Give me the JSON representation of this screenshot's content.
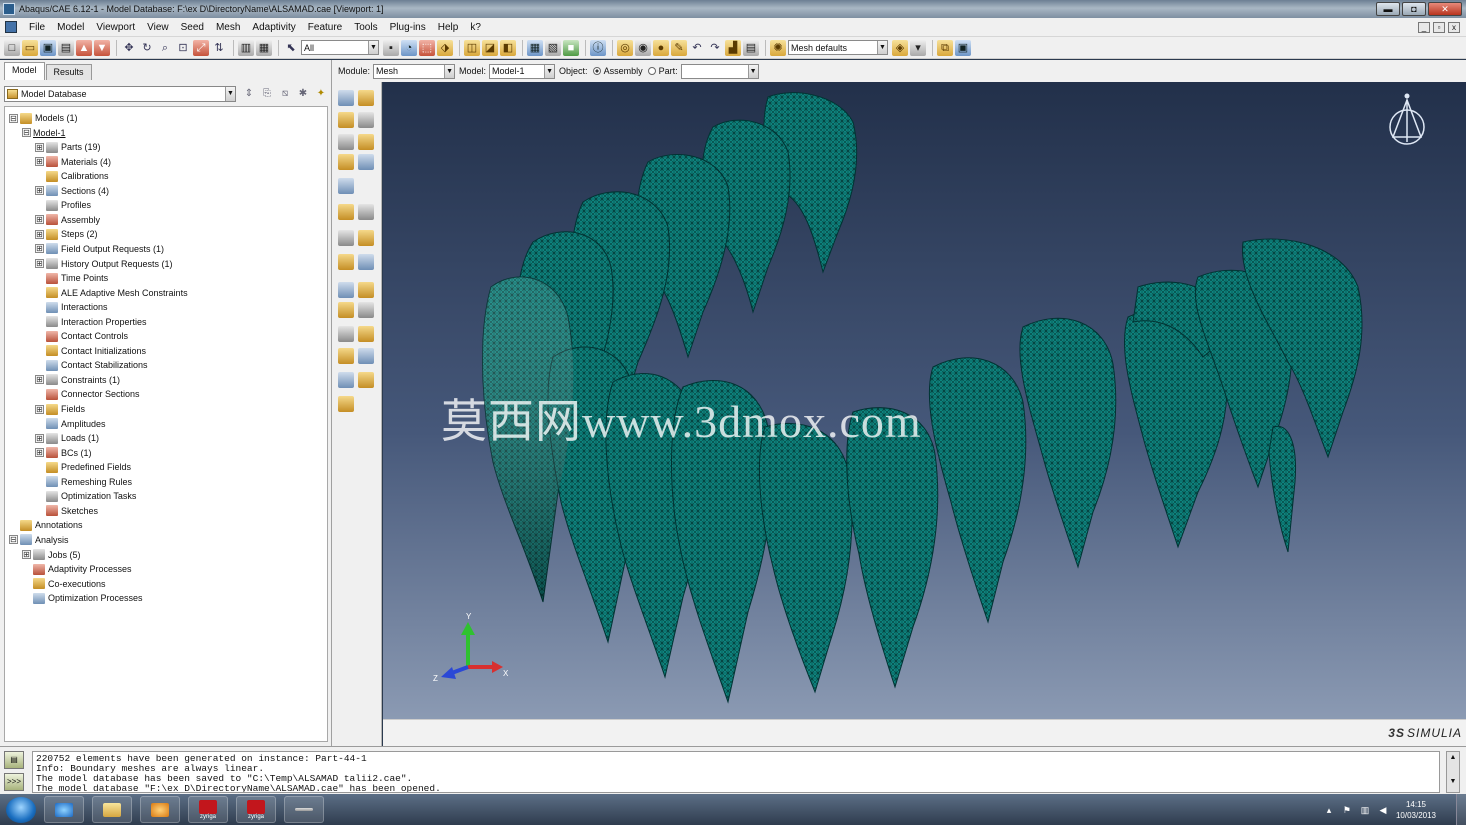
{
  "window": {
    "title": "Abaqus/CAE 6.12-1 - Model Database: F:\\ex D\\DirectoryName\\ALSAMAD.cae [Viewport: 1]",
    "min_glyph": "▬",
    "max_glyph": "◘",
    "close_glyph": "✕"
  },
  "menu": [
    "File",
    "Model",
    "Viewport",
    "View",
    "Seed",
    "Mesh",
    "Adaptivity",
    "Feature",
    "Tools",
    "Plug-ins",
    "Help",
    "k?"
  ],
  "toolbar": {
    "selection_filter": "All",
    "mesh_defaults": "Mesh defaults"
  },
  "left_panel": {
    "tabs": [
      "Model",
      "Results"
    ],
    "database_selector": "Model Database",
    "tree": [
      {
        "label": "Models (1)",
        "level": 0,
        "expander": "⊟",
        "icon": "models-icon"
      },
      {
        "label": "Model-1",
        "level": 1,
        "expander": "⊟",
        "icon": "",
        "underline": true
      },
      {
        "label": "Parts (19)",
        "level": 2,
        "expander": "⊞",
        "icon": "parts-icon"
      },
      {
        "label": "Materials (4)",
        "level": 2,
        "expander": "⊞",
        "icon": "materials-icon"
      },
      {
        "label": "Calibrations",
        "level": 2,
        "expander": "",
        "icon": "calibrations-icon"
      },
      {
        "label": "Sections (4)",
        "level": 2,
        "expander": "⊞",
        "icon": "sections-icon"
      },
      {
        "label": "Profiles",
        "level": 2,
        "expander": "",
        "icon": "profiles-icon"
      },
      {
        "label": "Assembly",
        "level": 2,
        "expander": "⊞",
        "icon": "assembly-icon"
      },
      {
        "label": "Steps (2)",
        "level": 2,
        "expander": "⊞",
        "icon": "steps-icon"
      },
      {
        "label": "Field Output Requests (1)",
        "level": 2,
        "expander": "⊞",
        "icon": "field-output-icon"
      },
      {
        "label": "History Output Requests (1)",
        "level": 2,
        "expander": "⊞",
        "icon": "history-output-icon"
      },
      {
        "label": "Time Points",
        "level": 2,
        "expander": "",
        "icon": "time-points-icon"
      },
      {
        "label": "ALE Adaptive Mesh Constraints",
        "level": 2,
        "expander": "",
        "icon": "ale-constraints-icon"
      },
      {
        "label": "Interactions",
        "level": 2,
        "expander": "",
        "icon": "interactions-icon"
      },
      {
        "label": "Interaction Properties",
        "level": 2,
        "expander": "",
        "icon": "interaction-properties-icon"
      },
      {
        "label": "Contact Controls",
        "level": 2,
        "expander": "",
        "icon": "contact-controls-icon"
      },
      {
        "label": "Contact Initializations",
        "level": 2,
        "expander": "",
        "icon": "contact-init-icon"
      },
      {
        "label": "Contact Stabilizations",
        "level": 2,
        "expander": "",
        "icon": "contact-stab-icon"
      },
      {
        "label": "Constraints (1)",
        "level": 2,
        "expander": "⊞",
        "icon": "constraints-icon"
      },
      {
        "label": "Connector Sections",
        "level": 2,
        "expander": "",
        "icon": "connector-sections-icon"
      },
      {
        "label": "Fields",
        "level": 2,
        "expander": "⊞",
        "icon": "fields-icon"
      },
      {
        "label": "Amplitudes",
        "level": 2,
        "expander": "",
        "icon": "amplitudes-icon"
      },
      {
        "label": "Loads (1)",
        "level": 2,
        "expander": "⊞",
        "icon": "loads-icon"
      },
      {
        "label": "BCs (1)",
        "level": 2,
        "expander": "⊞",
        "icon": "bcs-icon"
      },
      {
        "label": "Predefined Fields",
        "level": 2,
        "expander": "",
        "icon": "predefined-fields-icon"
      },
      {
        "label": "Remeshing Rules",
        "level": 2,
        "expander": "",
        "icon": "remeshing-icon"
      },
      {
        "label": "Optimization Tasks",
        "level": 2,
        "expander": "",
        "icon": "optimization-tasks-icon"
      },
      {
        "label": "Sketches",
        "level": 2,
        "expander": "",
        "icon": "sketches-icon"
      },
      {
        "label": "Annotations",
        "level": 0,
        "expander": "",
        "icon": "annotations-icon"
      },
      {
        "label": "Analysis",
        "level": 0,
        "expander": "⊟",
        "icon": "analysis-icon"
      },
      {
        "label": "Jobs (5)",
        "level": 1,
        "expander": "⊞",
        "icon": "jobs-icon"
      },
      {
        "label": "Adaptivity Processes",
        "level": 1,
        "expander": "",
        "icon": "adaptivity-icon"
      },
      {
        "label": "Co-executions",
        "level": 1,
        "expander": "",
        "icon": "co-executions-icon"
      },
      {
        "label": "Optimization Processes",
        "level": 1,
        "expander": "",
        "icon": "optimization-processes-icon"
      }
    ]
  },
  "module_bar": {
    "module_label": "Module:",
    "module_value": "Mesh",
    "model_label": "Model:",
    "model_value": "Model-1",
    "object_label": "Object:",
    "assembly_label": "Assembly",
    "part_label": "Part:",
    "part_value": ""
  },
  "viewport": {
    "watermark": "莫西网www.3dmox.com",
    "mesh_color": "#0e7f7a",
    "triad_labels": {
      "x": "X",
      "y": "Y",
      "z": "Z"
    },
    "brand": "SIMULIA",
    "brand_prefix": "3S"
  },
  "messages": [
    "220752 elements have been generated on instance: Part-44-1",
    "Info: Boundary meshes are always linear.",
    "The model database has been saved to \"C:\\Temp\\ALSAMAD talii2.cae\".",
    "The model database \"F:\\ex D\\DirectoryName\\ALSAMAD.cae\" has been opened."
  ],
  "taskbar": {
    "app_caption_1": "zyriga",
    "app_caption_2": "zyriga",
    "time": "14:15",
    "date": "10/03/2013"
  }
}
